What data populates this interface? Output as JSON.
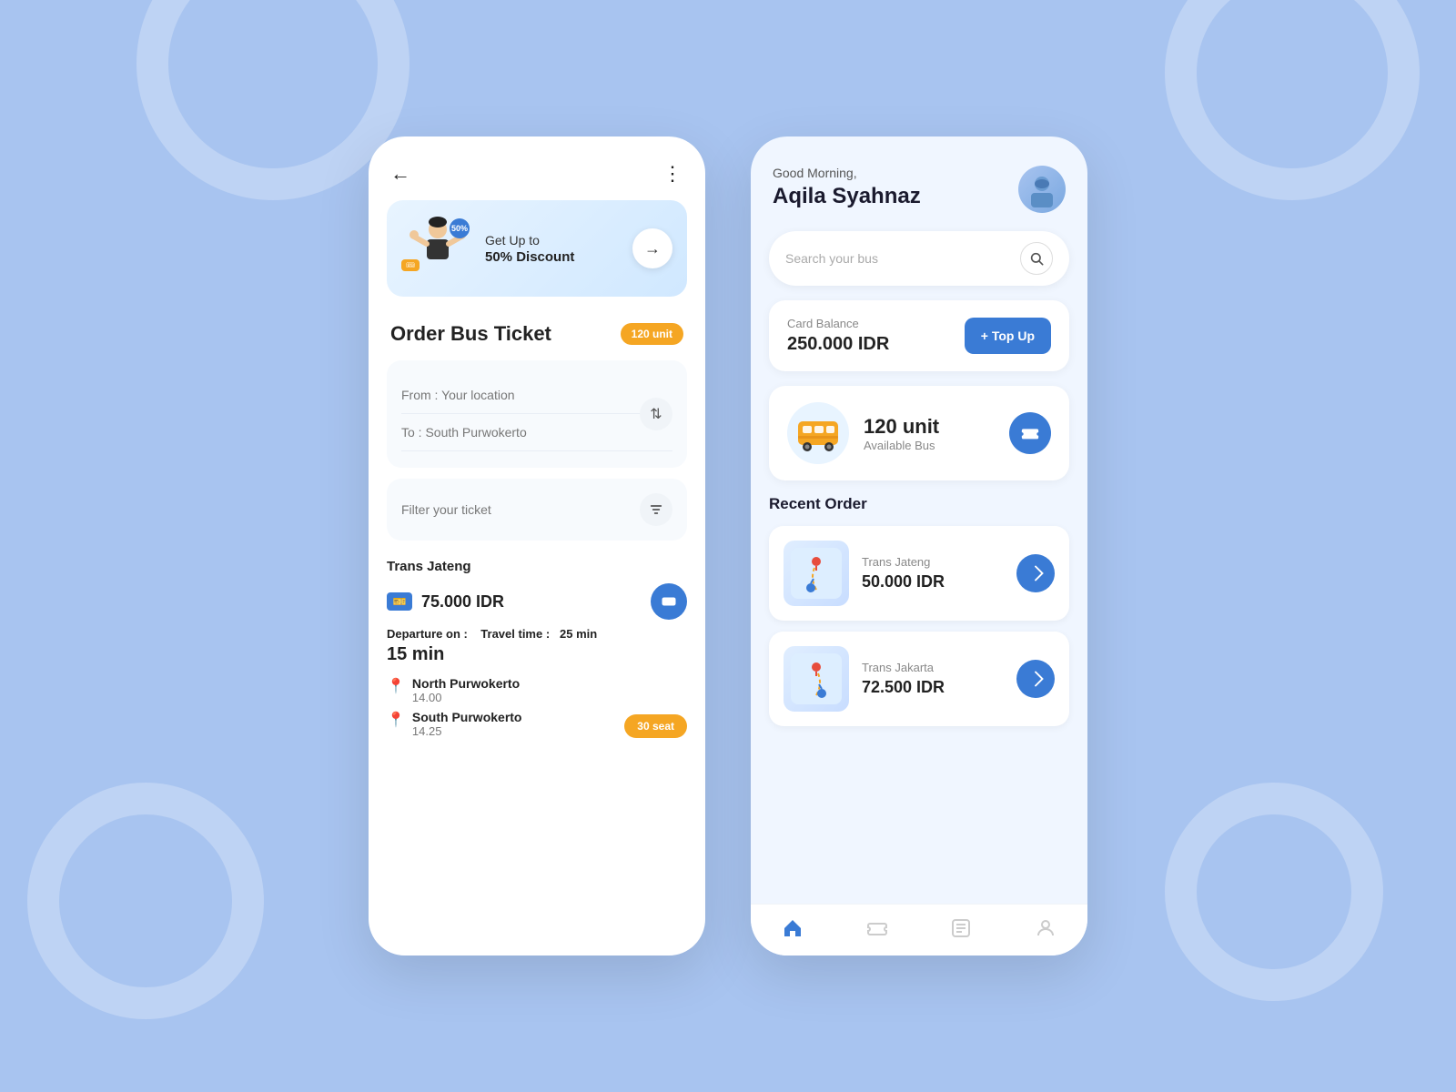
{
  "background": {
    "color": "#a8c4f0"
  },
  "leftPhone": {
    "header": {
      "back_label": "←",
      "more_label": "⋮"
    },
    "promo": {
      "title_line1": "Get Up to",
      "title_line2": "50% Discount",
      "badge": "50%",
      "arrow": "→"
    },
    "page": {
      "title": "Order Bus Ticket",
      "badge": "120 unit"
    },
    "form": {
      "from_label": "From : Your location",
      "to_label": "To : South Purwokerto",
      "swap_icon": "⇅",
      "filter_label": "Filter your ticket",
      "filter_icon": "▼"
    },
    "ticket": {
      "provider": "Trans Jateng",
      "price": "75.000 IDR",
      "departure_label": "Departure on :",
      "travel_label": "Travel time :",
      "travel_time": "25 min",
      "wait_time": "15 min",
      "stop1_name": "North Purwokerto",
      "stop1_time": "14.00",
      "stop2_name": "South Purwokerto",
      "stop2_time": "14.25",
      "seat_badge": "30 seat"
    }
  },
  "rightPhone": {
    "greeting": {
      "small": "Good Morning,",
      "name": "Aqila Syahnaz"
    },
    "search": {
      "placeholder": "Search your bus",
      "icon": "🔍"
    },
    "balance": {
      "label": "Card Balance",
      "amount": "250.000 IDR",
      "topup_label": "+ Top Up"
    },
    "bus": {
      "count": "120 unit",
      "available": "Available Bus",
      "ticket_icon": "🎫"
    },
    "recentOrders": {
      "title": "Recent Order",
      "orders": [
        {
          "provider": "Trans Jateng",
          "price": "50.000 IDR"
        },
        {
          "provider": "Trans Jakarta",
          "price": "72.500 IDR"
        }
      ]
    },
    "bottomNav": {
      "home_icon": "🏠",
      "ticket_icon": "🎫",
      "history_icon": "📋",
      "profile_icon": "👤"
    }
  }
}
